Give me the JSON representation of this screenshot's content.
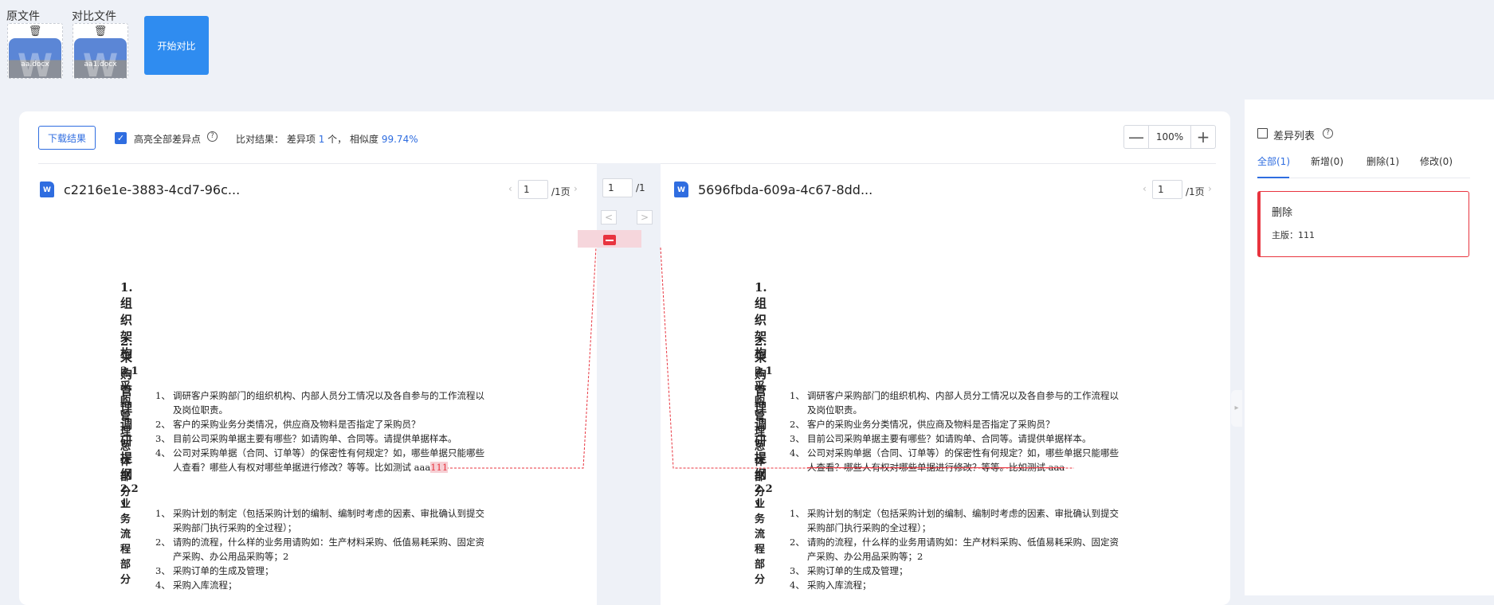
{
  "upload": {
    "original_label": "原文件",
    "compare_label": "对比文件",
    "original_file": "aa.docx",
    "compare_file": "aa1.docx",
    "start_button": "开始对比"
  },
  "toolbar": {
    "download_button": "下载结果",
    "highlight_all_label": "高亮全部差异点",
    "result_prefix": "比对结果：",
    "diff_label": "差异项",
    "diff_count": "1",
    "diff_unit": "个，",
    "similarity_label": "相似度",
    "similarity_value": "99.74%",
    "zoom_value": "100%",
    "zoom_out": "—",
    "zoom_in": "+"
  },
  "colors": {
    "accent": "#2f6de0",
    "diff_red": "#e8343f",
    "button_blue": "#2f8cf0"
  },
  "left_doc": {
    "title": "c2216e1e-3883-4cd7-96c...",
    "page": "1",
    "page_total": "/1页"
  },
  "middle": {
    "page": "1",
    "page_total": "/1",
    "prev": "<",
    "next": ">"
  },
  "right_doc": {
    "title": "5696fbda-609a-4c67-8dd...",
    "page": "1",
    "page_total": "/1页"
  },
  "content": {
    "h1_1": "1.  组织架构",
    "h1_2": "2.  采购管理调研提纲",
    "h2_1": "2.1   采购管理总体部分 1",
    "items1": [
      {
        "n": "1、",
        "a": "调研客户采购部门的组织机构、内部人员分工情况以及各自参与的工作流程以",
        "b": "及岗位职责。"
      },
      {
        "n": "2、",
        "a": "客户的采购业务分类情况，供应商及物料是否指定了采购员？"
      },
      {
        "n": "3、",
        "a": "目前公司采购单据主要有哪些？如请购单、合同等。请提供单据样本。"
      },
      {
        "n": "4、",
        "a": "公司对采购单据（合同、订单等）的保密性有何规定？如，哪些单据只能哪些",
        "b": "人查看？哪些人有权对哪些单据进行修改？等等。比如测试 aaa"
      }
    ],
    "left_diff": "111",
    "h2_2": "2.2   业务流程部分",
    "items2": [
      {
        "n": "1、",
        "a": "采购计划的制定（包括采购计划的编制、编制时考虑的因素、审批确认到提交",
        "b": "采购部门执行采购的全过程）；"
      },
      {
        "n": "2、",
        "a": "请购的流程，什么样的业务用请购如：生产材料采购、低值易耗采购、固定资",
        "b": "产采购、办公用品采购等；2"
      },
      {
        "n": "3、",
        "a": "采购订单的生成及管理；"
      },
      {
        "n": "4、",
        "a": "采购入库流程；"
      }
    ]
  },
  "sidebar": {
    "title": "差异列表",
    "tabs": [
      "全部(1)",
      "新增(0)",
      "删除(1)",
      "修改(0)"
    ],
    "card_type": "删除",
    "card_detail": "主版：111"
  }
}
